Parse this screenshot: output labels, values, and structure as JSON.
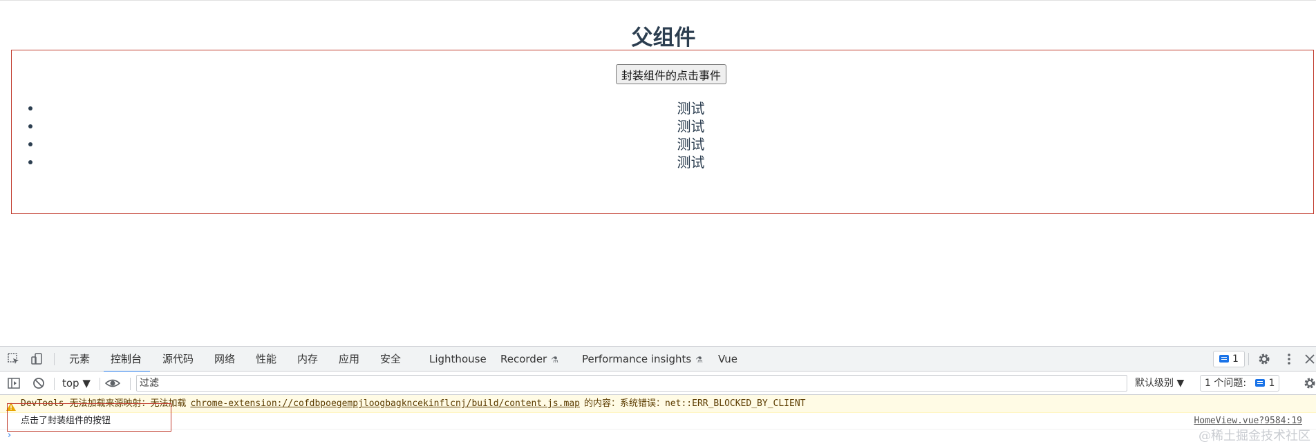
{
  "page": {
    "title": "父组件",
    "button_label": "封装组件的点击事件",
    "list_items": [
      "测试",
      "测试",
      "测试",
      "测试"
    ]
  },
  "devtools": {
    "tabs": [
      {
        "label": "元素"
      },
      {
        "label": "控制台",
        "active": true
      },
      {
        "label": "源代码"
      },
      {
        "label": "网络"
      },
      {
        "label": "性能"
      },
      {
        "label": "内存"
      },
      {
        "label": "应用"
      },
      {
        "label": "安全"
      },
      {
        "label": "Lighthouse"
      },
      {
        "label": "Recorder"
      },
      {
        "label": "Performance insights"
      },
      {
        "label": "Vue"
      }
    ],
    "issue_badge_count": "1",
    "toolbar": {
      "context": "top",
      "filter_placeholder": "过滤",
      "level": "默认级别",
      "issues_label": "1 个问题:",
      "issues_count": "1"
    },
    "console": {
      "warning_prefix": "DevTools 无法加载来源映射：无法加载",
      "warning_link": "chrome-extension://cofdbpoegempjloogbagkncekinflcnj/build/content.js.map",
      "warning_suffix": "的内容：系统错误：net::ERR_BLOCKED_BY_CLIENT",
      "log_message": "点击了封装组件的按钮",
      "log_source": "HomeView.vue?9584:19",
      "prompt_symbol": "›"
    }
  },
  "watermark": "@稀土掘金技术社区",
  "colors": {
    "accent": "#1a73e8",
    "highlight": "#c0392b",
    "text": "#2c3e50",
    "warning_bg": "#fffbe5"
  }
}
